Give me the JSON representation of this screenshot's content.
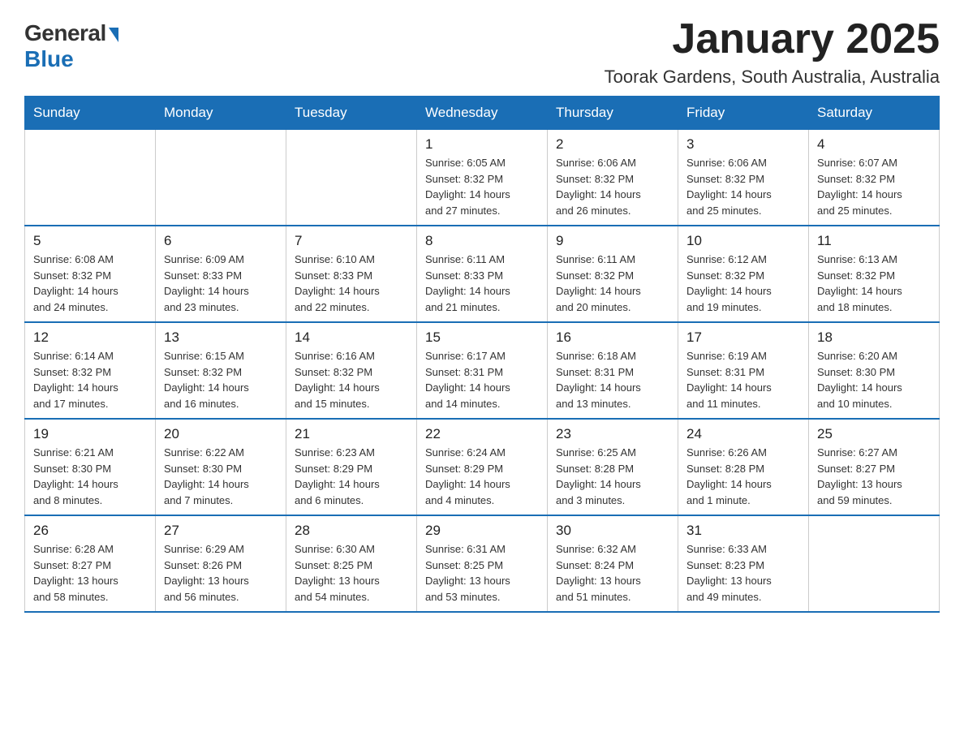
{
  "logo": {
    "general": "General",
    "blue": "Blue"
  },
  "title": "January 2025",
  "location": "Toorak Gardens, South Australia, Australia",
  "weekdays": [
    "Sunday",
    "Monday",
    "Tuesday",
    "Wednesday",
    "Thursday",
    "Friday",
    "Saturday"
  ],
  "weeks": [
    [
      {
        "day": "",
        "info": ""
      },
      {
        "day": "",
        "info": ""
      },
      {
        "day": "",
        "info": ""
      },
      {
        "day": "1",
        "info": "Sunrise: 6:05 AM\nSunset: 8:32 PM\nDaylight: 14 hours\nand 27 minutes."
      },
      {
        "day": "2",
        "info": "Sunrise: 6:06 AM\nSunset: 8:32 PM\nDaylight: 14 hours\nand 26 minutes."
      },
      {
        "day": "3",
        "info": "Sunrise: 6:06 AM\nSunset: 8:32 PM\nDaylight: 14 hours\nand 25 minutes."
      },
      {
        "day": "4",
        "info": "Sunrise: 6:07 AM\nSunset: 8:32 PM\nDaylight: 14 hours\nand 25 minutes."
      }
    ],
    [
      {
        "day": "5",
        "info": "Sunrise: 6:08 AM\nSunset: 8:32 PM\nDaylight: 14 hours\nand 24 minutes."
      },
      {
        "day": "6",
        "info": "Sunrise: 6:09 AM\nSunset: 8:33 PM\nDaylight: 14 hours\nand 23 minutes."
      },
      {
        "day": "7",
        "info": "Sunrise: 6:10 AM\nSunset: 8:33 PM\nDaylight: 14 hours\nand 22 minutes."
      },
      {
        "day": "8",
        "info": "Sunrise: 6:11 AM\nSunset: 8:33 PM\nDaylight: 14 hours\nand 21 minutes."
      },
      {
        "day": "9",
        "info": "Sunrise: 6:11 AM\nSunset: 8:32 PM\nDaylight: 14 hours\nand 20 minutes."
      },
      {
        "day": "10",
        "info": "Sunrise: 6:12 AM\nSunset: 8:32 PM\nDaylight: 14 hours\nand 19 minutes."
      },
      {
        "day": "11",
        "info": "Sunrise: 6:13 AM\nSunset: 8:32 PM\nDaylight: 14 hours\nand 18 minutes."
      }
    ],
    [
      {
        "day": "12",
        "info": "Sunrise: 6:14 AM\nSunset: 8:32 PM\nDaylight: 14 hours\nand 17 minutes."
      },
      {
        "day": "13",
        "info": "Sunrise: 6:15 AM\nSunset: 8:32 PM\nDaylight: 14 hours\nand 16 minutes."
      },
      {
        "day": "14",
        "info": "Sunrise: 6:16 AM\nSunset: 8:32 PM\nDaylight: 14 hours\nand 15 minutes."
      },
      {
        "day": "15",
        "info": "Sunrise: 6:17 AM\nSunset: 8:31 PM\nDaylight: 14 hours\nand 14 minutes."
      },
      {
        "day": "16",
        "info": "Sunrise: 6:18 AM\nSunset: 8:31 PM\nDaylight: 14 hours\nand 13 minutes."
      },
      {
        "day": "17",
        "info": "Sunrise: 6:19 AM\nSunset: 8:31 PM\nDaylight: 14 hours\nand 11 minutes."
      },
      {
        "day": "18",
        "info": "Sunrise: 6:20 AM\nSunset: 8:30 PM\nDaylight: 14 hours\nand 10 minutes."
      }
    ],
    [
      {
        "day": "19",
        "info": "Sunrise: 6:21 AM\nSunset: 8:30 PM\nDaylight: 14 hours\nand 8 minutes."
      },
      {
        "day": "20",
        "info": "Sunrise: 6:22 AM\nSunset: 8:30 PM\nDaylight: 14 hours\nand 7 minutes."
      },
      {
        "day": "21",
        "info": "Sunrise: 6:23 AM\nSunset: 8:29 PM\nDaylight: 14 hours\nand 6 minutes."
      },
      {
        "day": "22",
        "info": "Sunrise: 6:24 AM\nSunset: 8:29 PM\nDaylight: 14 hours\nand 4 minutes."
      },
      {
        "day": "23",
        "info": "Sunrise: 6:25 AM\nSunset: 8:28 PM\nDaylight: 14 hours\nand 3 minutes."
      },
      {
        "day": "24",
        "info": "Sunrise: 6:26 AM\nSunset: 8:28 PM\nDaylight: 14 hours\nand 1 minute."
      },
      {
        "day": "25",
        "info": "Sunrise: 6:27 AM\nSunset: 8:27 PM\nDaylight: 13 hours\nand 59 minutes."
      }
    ],
    [
      {
        "day": "26",
        "info": "Sunrise: 6:28 AM\nSunset: 8:27 PM\nDaylight: 13 hours\nand 58 minutes."
      },
      {
        "day": "27",
        "info": "Sunrise: 6:29 AM\nSunset: 8:26 PM\nDaylight: 13 hours\nand 56 minutes."
      },
      {
        "day": "28",
        "info": "Sunrise: 6:30 AM\nSunset: 8:25 PM\nDaylight: 13 hours\nand 54 minutes."
      },
      {
        "day": "29",
        "info": "Sunrise: 6:31 AM\nSunset: 8:25 PM\nDaylight: 13 hours\nand 53 minutes."
      },
      {
        "day": "30",
        "info": "Sunrise: 6:32 AM\nSunset: 8:24 PM\nDaylight: 13 hours\nand 51 minutes."
      },
      {
        "day": "31",
        "info": "Sunrise: 6:33 AM\nSunset: 8:23 PM\nDaylight: 13 hours\nand 49 minutes."
      },
      {
        "day": "",
        "info": ""
      }
    ]
  ]
}
